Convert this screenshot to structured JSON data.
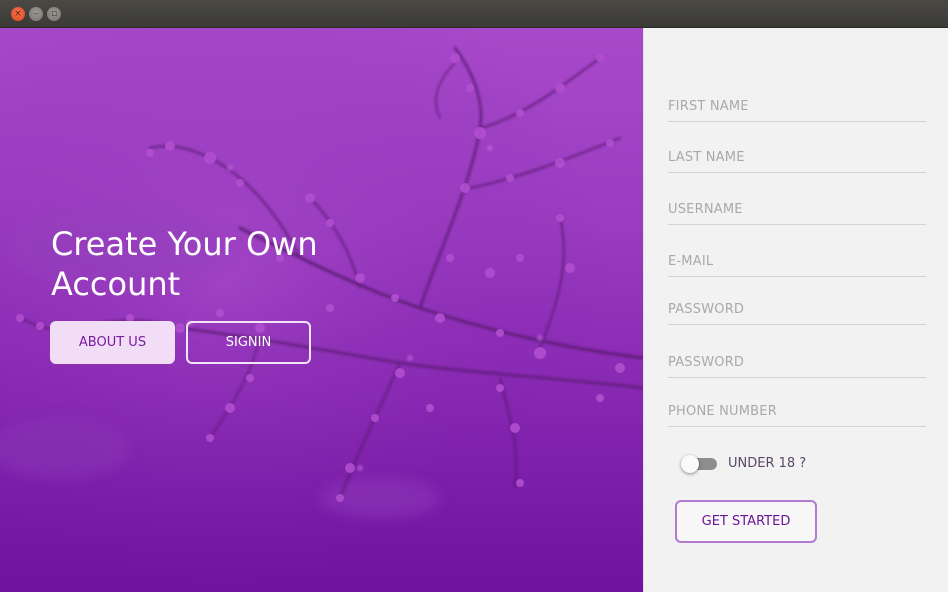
{
  "window": {
    "controls": [
      {
        "name": "close-icon",
        "glyph": "×"
      },
      {
        "name": "minimize-icon",
        "glyph": "–"
      },
      {
        "name": "maximize-icon",
        "glyph": "▫"
      }
    ]
  },
  "hero": {
    "title": "Create Your Own Account",
    "about_label": "ABOUT US",
    "signin_label": "SIGNIN"
  },
  "form": {
    "first_name": {
      "placeholder": "FIRST NAME",
      "value": ""
    },
    "last_name": {
      "placeholder": "LAST NAME",
      "value": ""
    },
    "username": {
      "placeholder": "USERNAME",
      "value": ""
    },
    "email": {
      "placeholder": "E-MAIL",
      "value": ""
    },
    "password": {
      "placeholder": "PASSWORD",
      "value": ""
    },
    "password_confirm": {
      "placeholder": "PASSWORD",
      "value": ""
    },
    "phone": {
      "placeholder": "PHONE NUMBER",
      "value": ""
    },
    "under18": {
      "label": "UNDER 18 ?",
      "checked": false
    },
    "submit_label": "GET STARTED"
  },
  "colors": {
    "accent": "#7a1aa0",
    "hero_top": "#a749c9",
    "hero_bottom": "#6e12a0",
    "form_bg": "#f2f2f2"
  }
}
